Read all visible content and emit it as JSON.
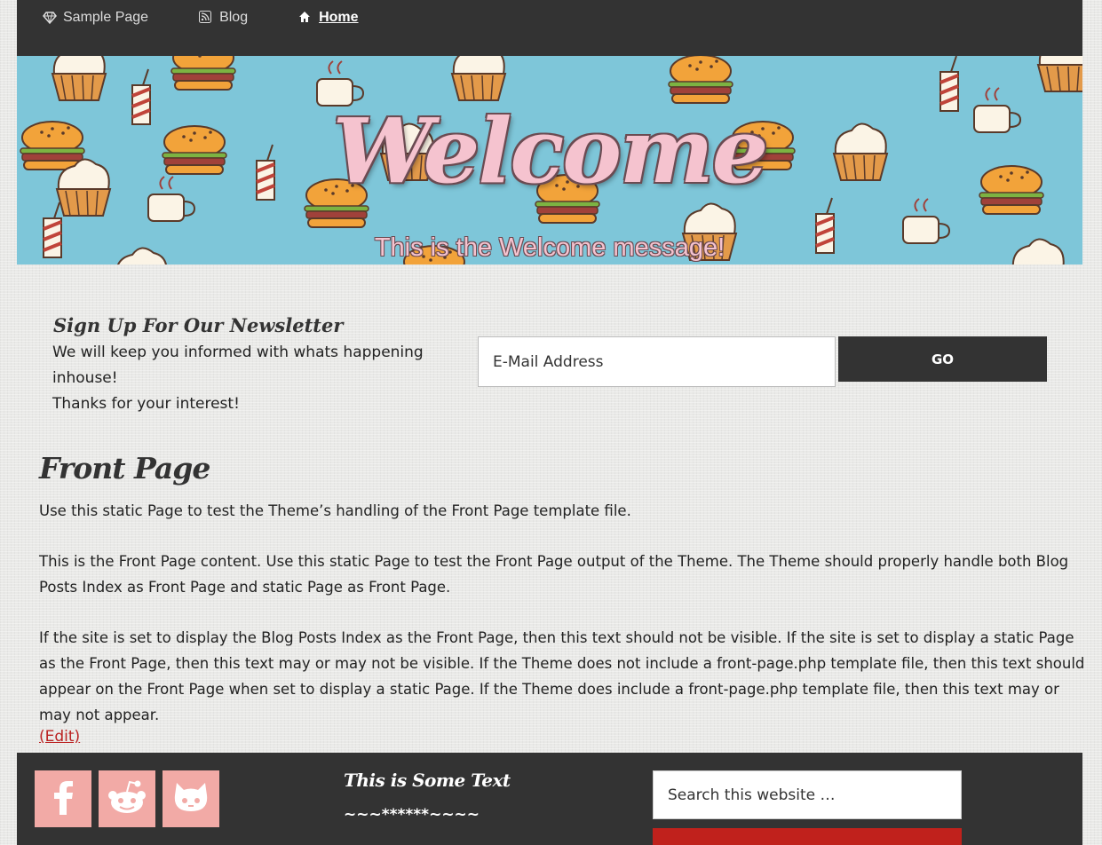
{
  "nav": {
    "items": [
      {
        "label": "Sample Page",
        "icon": "diamond-icon"
      },
      {
        "label": "Blog",
        "icon": "rss-icon"
      },
      {
        "label": " Home",
        "icon": "home-icon",
        "active": true
      }
    ]
  },
  "hero": {
    "title": "Welcome",
    "subtitle": "This is the Welcome message!"
  },
  "newsletter": {
    "title": "Sign Up For Our Newsletter",
    "line1": "We will keep you informed with whats happening inhouse!",
    "line2": "Thanks for your interest!",
    "email_placeholder": "E-Mail Address",
    "button_label": "GO"
  },
  "page": {
    "title": "Front Page",
    "paragraphs": [
      "Use this static Page to test the Theme’s handling of the Front Page template file.",
      "This is the Front Page content. Use this static Page to test the Front Page output of the Theme. The Theme should properly handle both Blog Posts Index as Front Page and static Page as Front Page.",
      "If the site is set to display the Blog Posts Index as the Front Page, then this text should not be visible. If the site is set to display a static Page as the Front Page, then this text may or may not be visible. If the Theme does not include a front-page.php template file, then this text should appear on the Front Page when set to display a static Page. If the Theme does include a front-page.php template file, then this text may or may not appear."
    ],
    "edit_label": "(Edit)"
  },
  "footer": {
    "social": [
      "facebook-icon",
      "reddit-icon",
      "github-icon"
    ],
    "widget_title": "This is Some Text",
    "widget_text": "~~~******~~~~",
    "search_placeholder": "Search this website …"
  },
  "colors": {
    "dark": "#333333",
    "hero_bg": "#7ec6d9",
    "pink": "#f5c3cf",
    "social_bg": "#f2aaa6",
    "accent_red": "#c0211c"
  }
}
